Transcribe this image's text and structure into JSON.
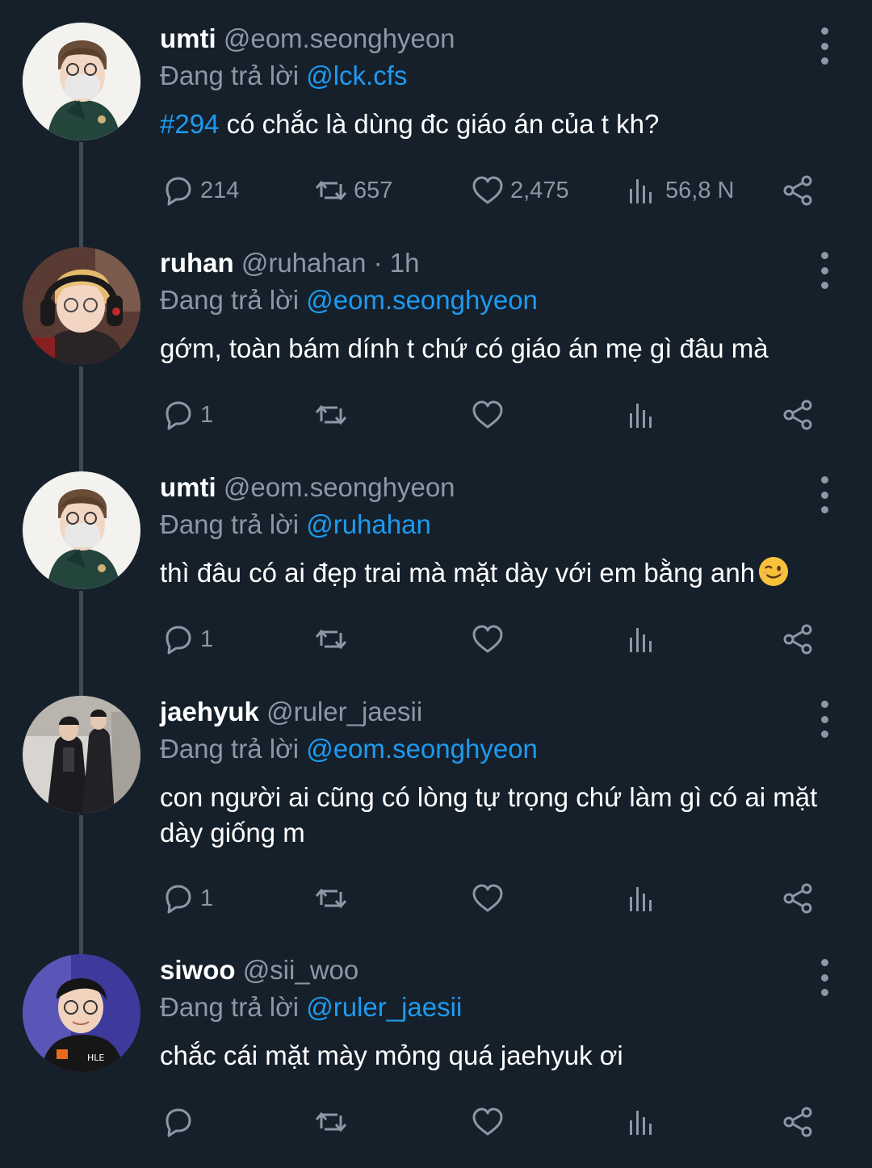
{
  "tweets": [
    {
      "name": "umti",
      "handle": "@eom.seonghyeon",
      "time": "",
      "replying_label": "Đang trả lời",
      "replying_to": "@lck.cfs",
      "hashtag": "#294",
      "text": " có chắc là dùng đc giáo án của t kh?",
      "replies": "214",
      "retweets": "657",
      "likes": "2,475",
      "views": "56,8 N"
    },
    {
      "name": "ruhan",
      "handle": "@ruhahan",
      "time": " · 1h",
      "replying_label": "Đang trả lời",
      "replying_to": "@eom.seonghyeon",
      "hashtag": "",
      "text": "gớm, toàn bám dính t chứ có giáo án mẹ gì đâu mà",
      "replies": "1",
      "retweets": "",
      "likes": "",
      "views": ""
    },
    {
      "name": "umti",
      "handle": "@eom.seonghyeon",
      "time": "",
      "replying_label": "Đang trả lời",
      "replying_to": "@ruhahan",
      "hashtag": "",
      "text": "thì đâu có ai đẹp trai mà mặt dày với em bằng anh",
      "emoji": "winking-face",
      "replies": "1",
      "retweets": "",
      "likes": "",
      "views": ""
    },
    {
      "name": "jaehyuk",
      "handle": "@ruler_jaesii",
      "time": "",
      "replying_label": "Đang trả lời",
      "replying_to": "@eom.seonghyeon",
      "hashtag": "",
      "text": "con người ai cũng có lòng tự trọng chứ làm gì có ai mặt dày giống m",
      "replies": "1",
      "retweets": "",
      "likes": "",
      "views": ""
    },
    {
      "name": "siwoo",
      "handle": "@sii_woo",
      "time": "",
      "replying_label": "Đang trả lời",
      "replying_to": "@ruler_jaesii",
      "hashtag": "",
      "text": "chắc cái mặt mày mỏng quá jaehyuk ơi",
      "replies": "",
      "retweets": "",
      "likes": "",
      "views": ""
    }
  ],
  "icons": {
    "reply": "speech-bubble-icon",
    "retweet": "retweet-arrows-icon",
    "like": "heart-icon",
    "views": "bar-chart-icon",
    "share": "share-icon",
    "more": "vertical-ellipsis-icon"
  },
  "colors": {
    "background": "#15202b",
    "text": "#ffffff",
    "muted": "#8b98a5",
    "link": "#1d9bf0",
    "thread_line": "#3d4954"
  }
}
